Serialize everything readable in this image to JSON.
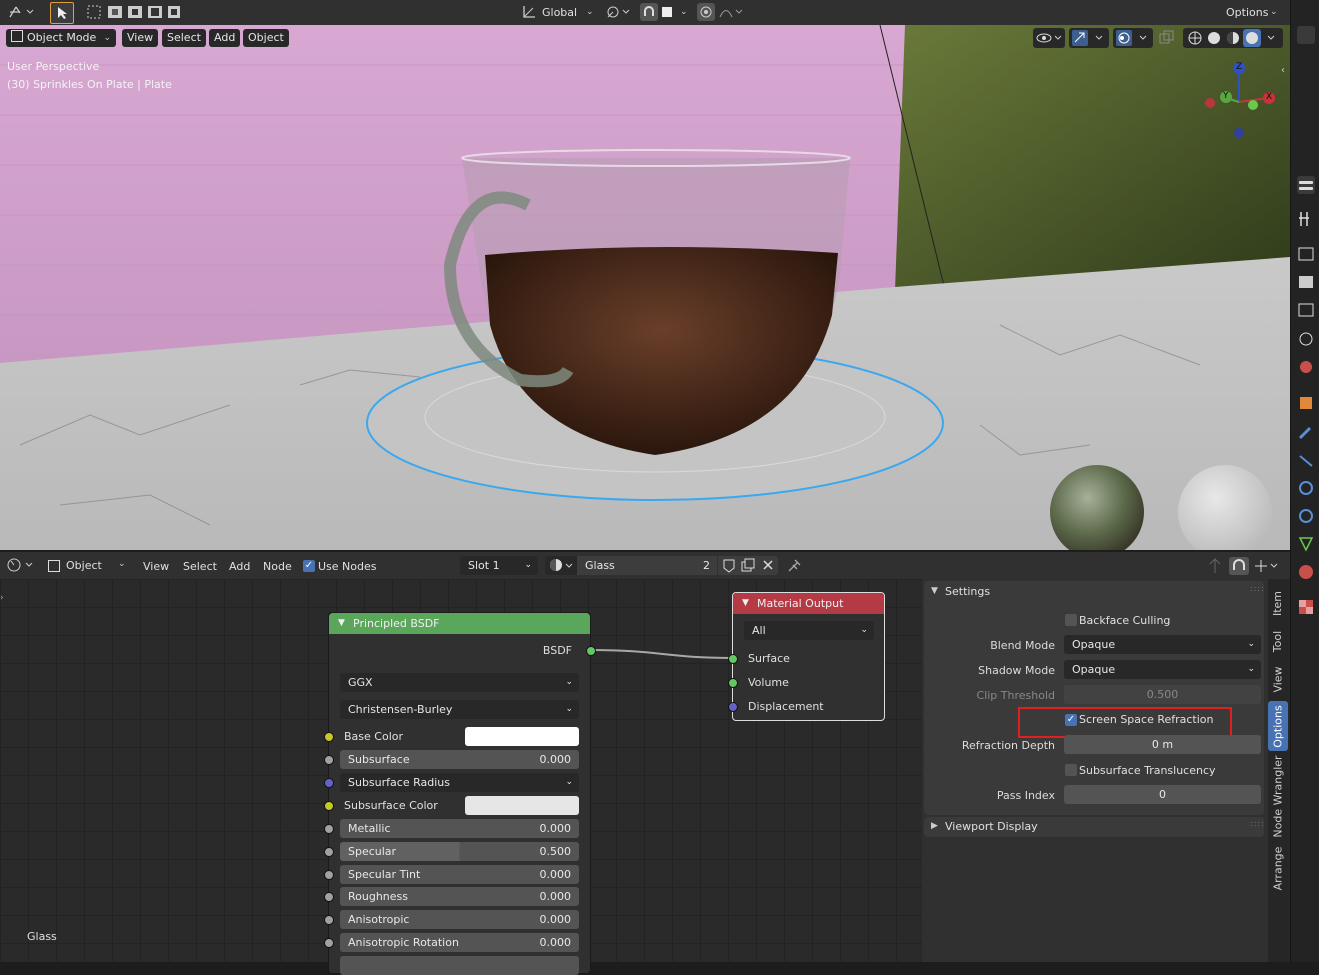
{
  "topbar": {
    "transform_orientation": "Global",
    "options_label": "Options"
  },
  "viewport_header": {
    "mode": "Object Mode",
    "menus": [
      "View",
      "Select",
      "Add",
      "Object"
    ]
  },
  "viewport": {
    "perspective_label": "User Perspective",
    "object_label": "(30) Sprinkles On Plate | Plate",
    "gizmo_axes": [
      "Z",
      "Y",
      "X"
    ]
  },
  "node_header": {
    "object_dropdown": "Object",
    "menus": [
      "View",
      "Select",
      "Add",
      "Node"
    ],
    "use_nodes_label": "Use Nodes",
    "use_nodes_checked": true,
    "slot": "Slot 1",
    "material_name": "Glass",
    "user_count": "2"
  },
  "nodes": {
    "principled": {
      "title": "Principled BSDF",
      "output_label": "BSDF",
      "distribution": "GGX",
      "subsurface_method": "Christensen-Burley",
      "base_color_label": "Base Color",
      "subsurface_label": "Subsurface",
      "subsurface_value": "0.000",
      "subsurface_radius_label": "Subsurface Radius",
      "subsurface_color_label": "Subsurface Color",
      "metallic_label": "Metallic",
      "metallic_value": "0.000",
      "specular_label": "Specular",
      "specular_value": "0.500",
      "specular_tint_label": "Specular Tint",
      "specular_tint_value": "0.000",
      "roughness_label": "Roughness",
      "roughness_value": "0.000",
      "anisotropic_label": "Anisotropic",
      "anisotropic_value": "0.000",
      "aniso_rotation_label": "Anisotropic Rotation",
      "aniso_rotation_value": "0.000"
    },
    "output": {
      "title": "Material Output",
      "target": "All",
      "surface_label": "Surface",
      "volume_label": "Volume",
      "displacement_label": "Displacement"
    },
    "canvas_material_label": "Glass"
  },
  "sidebar": {
    "settings_title": "Settings",
    "backface_culling_label": "Backface Culling",
    "blend_mode_label": "Blend Mode",
    "blend_mode_value": "Opaque",
    "shadow_mode_label": "Shadow Mode",
    "shadow_mode_value": "Opaque",
    "clip_threshold_label": "Clip Threshold",
    "clip_threshold_value": "0.500",
    "ssr_label": "Screen Space Refraction",
    "ssr_checked": true,
    "refraction_depth_label": "Refraction Depth",
    "refraction_depth_value": "0 m",
    "subsurface_translucency_label": "Subsurface Translucency",
    "pass_index_label": "Pass Index",
    "pass_index_value": "0",
    "viewport_display_title": "Viewport Display"
  },
  "sidebar_tabs": [
    "Item",
    "Tool",
    "View",
    "Options",
    "Node Wrangler",
    "Arrange"
  ],
  "active_tab": "Options",
  "colors": {
    "principled_header": "#5aa65a",
    "output_header": "#b43a46",
    "highlight_box": "#e02020",
    "active_tab": "#4772b3",
    "socket_shader": "#63c763",
    "socket_color": "#c7c729",
    "socket_float": "#a1a1a1",
    "socket_vector": "#6363c7"
  }
}
